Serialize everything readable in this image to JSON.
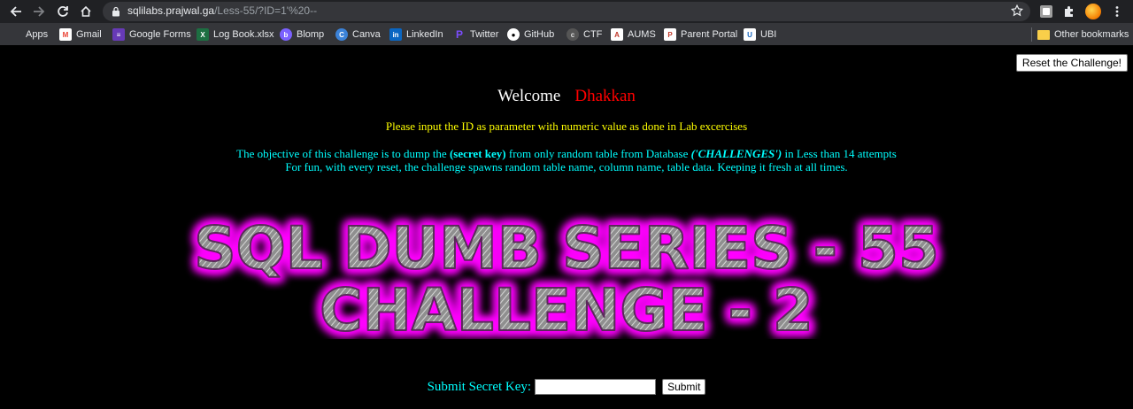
{
  "browser": {
    "url_host": "sqlilabs.prajwal.ga",
    "url_path": "/Less-55/?ID=1'%20--",
    "bookmarks": [
      {
        "label": "Apps",
        "icon": "apps-grid-icon",
        "color": "#ea4335"
      },
      {
        "label": "Gmail",
        "icon": "gmail-icon",
        "color": "#ea4335"
      },
      {
        "label": "Google Forms",
        "icon": "google-forms-icon",
        "color": "#673ab7"
      },
      {
        "label": "Log Book.xlsx",
        "icon": "excel-icon",
        "color": "#1d6f42"
      },
      {
        "label": "Blomp",
        "icon": "blomp-icon",
        "color": "#7b61ff"
      },
      {
        "label": "Canva",
        "icon": "canva-icon",
        "color": "#00c4cc"
      },
      {
        "label": "LinkedIn",
        "icon": "linkedin-icon",
        "color": "#0a66c2"
      },
      {
        "label": "Twitter",
        "icon": "twitter-icon",
        "color": "#7c4dff"
      },
      {
        "label": "GitHub",
        "icon": "github-icon",
        "color": "#ffffff"
      },
      {
        "label": "CTF",
        "icon": "ctf-icon",
        "color": "#888888"
      },
      {
        "label": "AUMS",
        "icon": "aums-icon",
        "color": "#c0392b"
      },
      {
        "label": "Parent Portal",
        "icon": "parent-portal-icon",
        "color": "#c0392b"
      },
      {
        "label": "UBI",
        "icon": "ubi-icon",
        "color": "#1565c0"
      }
    ],
    "other_bookmarks": "Other bookmarks"
  },
  "page": {
    "reset_label": "Reset the Challenge!",
    "welcome": "Welcome",
    "username": "Dhakkan",
    "instruction": "Please input the ID as parameter with numeric value as done in Lab excercises",
    "objective_pre": "The objective of this challenge is to dump the ",
    "objective_key": "(secret key)",
    "objective_mid": " from only random table from Database ",
    "objective_db": "('CHALLENGES')",
    "objective_post": " in Less than 14 attempts",
    "objective_line2": "For fun, with every reset, the challenge spawns random table name, column name, table data. Keeping it fresh at all times.",
    "banner_line1": "SQL DUMB SERIES - 55",
    "banner_line2": "CHALLENGE - 2",
    "submit_label": "Submit Secret Key:",
    "submit_value": "",
    "submit_button": "Submit"
  }
}
